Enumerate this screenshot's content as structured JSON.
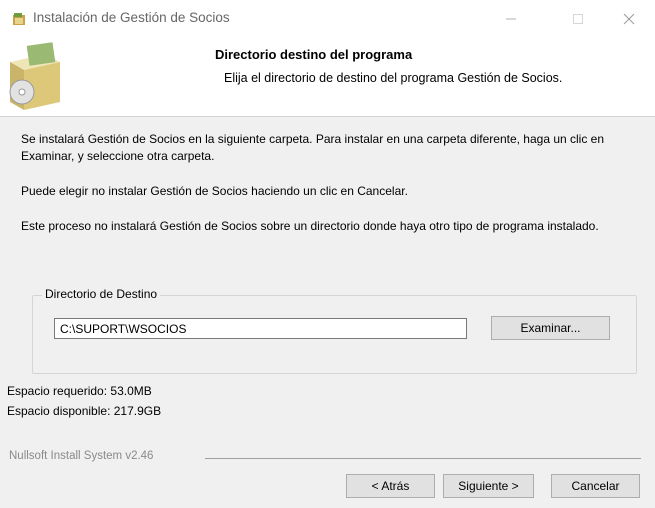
{
  "window": {
    "title": "Instalación de Gestión de Socios",
    "icon": "installer-icon",
    "controls": [
      "minimize-icon",
      "maximize-icon",
      "close-icon"
    ]
  },
  "header": {
    "title": "Directorio destino del programa",
    "subtitle": "Elija el directorio de destino del programa Gestión de Socios.",
    "image": "installer-box-icon"
  },
  "body": {
    "paragraph1": "Se instalará Gestión de Socios en la siguiente carpeta. Para instalar en una carpeta diferente, haga un clic en Examinar, y seleccione otra carpeta.",
    "paragraph2": "Puede elegir no instalar Gestión de Socios haciendo un clic en Cancelar.",
    "paragraph3": "Este proceso no instalará Gestión de Socios sobre un directorio donde haya otro tipo de programa instalado."
  },
  "destination": {
    "group_label": "Directorio de Destino",
    "path_value": "C:\\SUPORT\\WSOCIOS",
    "browse_label": "Examinar..."
  },
  "space": {
    "required": "Espacio requerido: 53.0MB",
    "available": "Espacio disponible: 217.9GB"
  },
  "footer": {
    "branding": "Nullsoft Install System v2.46",
    "back_label": "< Atrás",
    "next_label": "Siguiente >",
    "cancel_label": "Cancelar"
  },
  "colors": {
    "window_bg": "#f0f0f0",
    "header_bg": "#ffffff",
    "button_bg": "#e1e1e1",
    "button_border": "#adadad"
  }
}
